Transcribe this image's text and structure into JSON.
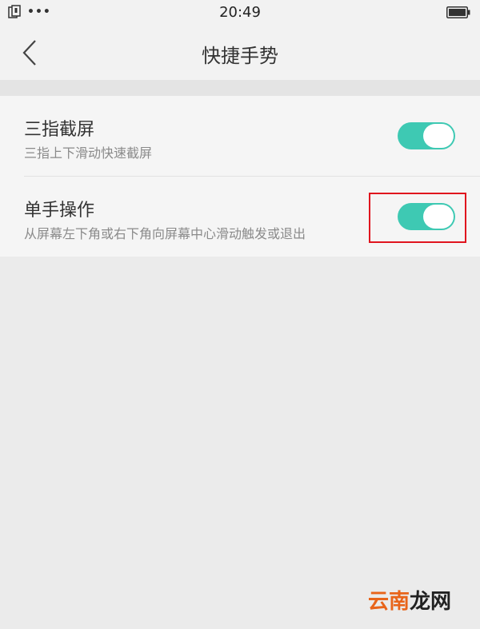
{
  "status_bar": {
    "time": "20:49",
    "dots": "•••",
    "icons": [
      "sim-card-icon",
      "battery-icon"
    ]
  },
  "header": {
    "title": "快捷手势",
    "back_icon": "chevron-left-icon"
  },
  "settings": {
    "items": [
      {
        "title": "三指截屏",
        "subtitle": "三指上下滑动快速截屏",
        "enabled": true
      },
      {
        "title": "单手操作",
        "subtitle": "从屏幕左下角或右下角向屏幕中心滑动触发或退出",
        "enabled": true
      }
    ]
  },
  "colors": {
    "toggle_on": "#3ec9b3",
    "highlight": "#e0141e",
    "background": "#ebebeb"
  },
  "watermark": {
    "part1": "云南",
    "part2": "龙网"
  }
}
